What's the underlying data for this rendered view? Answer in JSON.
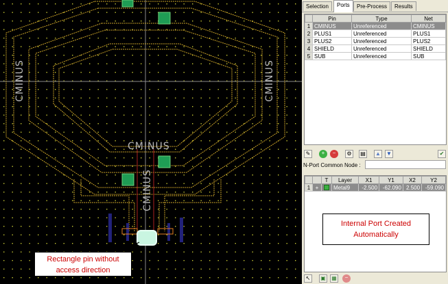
{
  "canvas": {
    "labels": {
      "top_left": "CMINUS",
      "top_right": "CMINUS",
      "center": "CMINUS",
      "bottom_vertical": "CMINUS"
    },
    "callouts": {
      "rect_pin": "Rectangle pin without access direction",
      "internal_port": "Internal Port Created Automatically"
    }
  },
  "panel": {
    "tabs": [
      {
        "label": "Selection",
        "active": false
      },
      {
        "label": "Ports",
        "active": true
      },
      {
        "label": "Pre-Process",
        "active": false
      },
      {
        "label": "Results",
        "active": false
      }
    ],
    "pins_table": {
      "headers": [
        "Pin",
        "Type",
        "Net"
      ],
      "rows": [
        {
          "n": "1",
          "pin": "CMINUS",
          "type": "Unreferenced",
          "net": "CMINUS"
        },
        {
          "n": "2",
          "pin": "PLUS1",
          "type": "Unreferenced",
          "net": "PLUS1"
        },
        {
          "n": "3",
          "pin": "PLUS2",
          "type": "Unreferenced",
          "net": "PLUS2"
        },
        {
          "n": "4",
          "pin": "SHIELD",
          "type": "Unreferenced",
          "net": "SHIELD"
        },
        {
          "n": "5",
          "pin": "SUB",
          "type": "Unreferenced",
          "net": "SUB"
        }
      ]
    },
    "nport_label": "N-Port Common Node :",
    "nport_value": "",
    "port_table": {
      "headers": [
        "T",
        "Layer",
        "X1",
        "Y1",
        "X2",
        "Y2"
      ],
      "rows": [
        {
          "n": "1",
          "layer": "Metal9",
          "x1": "-2.500",
          "y1": "-62.090",
          "x2": "2.500",
          "y2": "-59.090"
        }
      ]
    }
  }
}
